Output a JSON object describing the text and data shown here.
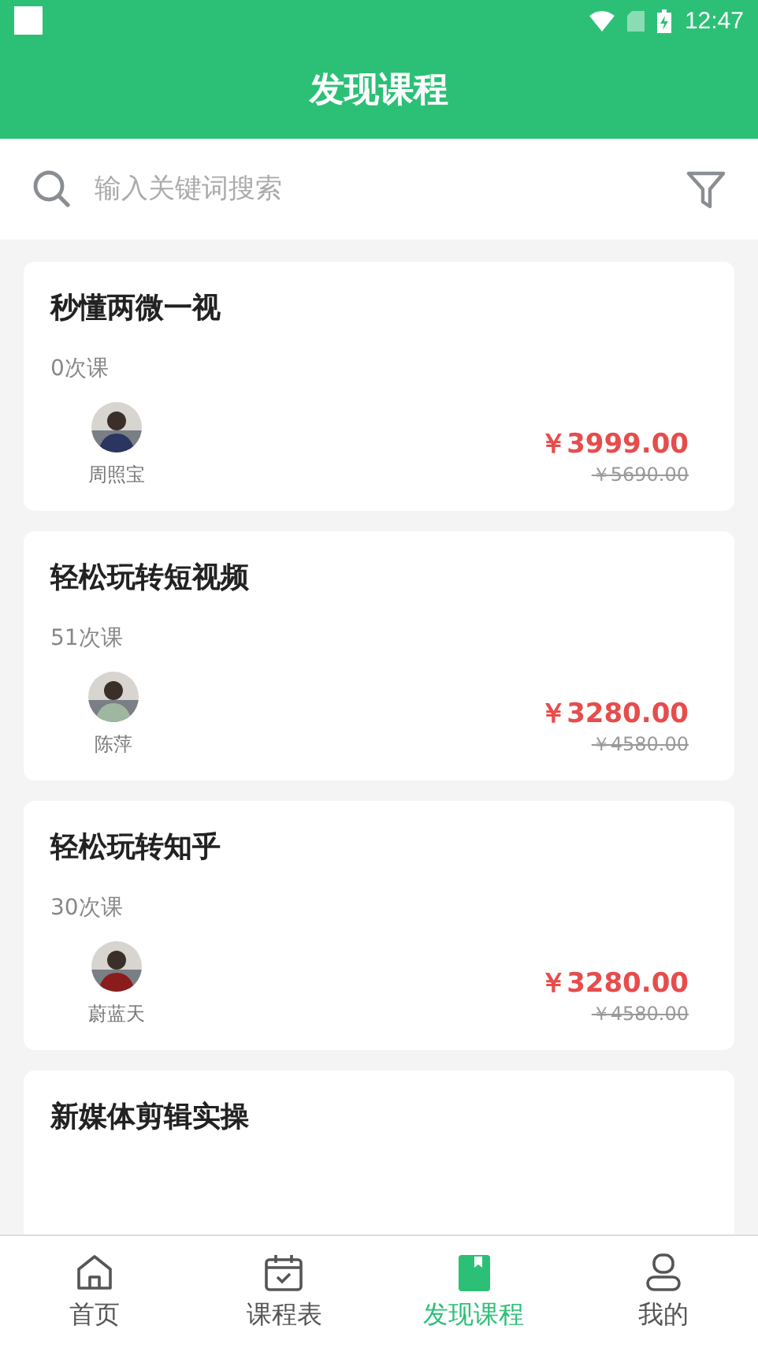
{
  "status_bar": {
    "time": "12:47"
  },
  "header": {
    "title": "发现课程"
  },
  "search": {
    "placeholder": "输入关键词搜索"
  },
  "courses": [
    {
      "title": "秒懂两微一视",
      "lessons": "0次课",
      "teacher": "周照宝",
      "price": "￥3999.00",
      "original_price": "￥5690.00"
    },
    {
      "title": "轻松玩转短视频",
      "lessons": "51次课",
      "teacher": "陈萍",
      "price": "￥3280.00",
      "original_price": "￥4580.00"
    },
    {
      "title": "轻松玩转知乎",
      "lessons": "30次课",
      "teacher": "蔚蓝天",
      "price": "￥3280.00",
      "original_price": "￥4580.00"
    },
    {
      "title": "新媒体剪辑实操"
    }
  ],
  "nav": [
    {
      "label": "首页",
      "selected": false
    },
    {
      "label": "课程表",
      "selected": false
    },
    {
      "label": "发现课程",
      "selected": true
    },
    {
      "label": "我的",
      "selected": false
    }
  ]
}
